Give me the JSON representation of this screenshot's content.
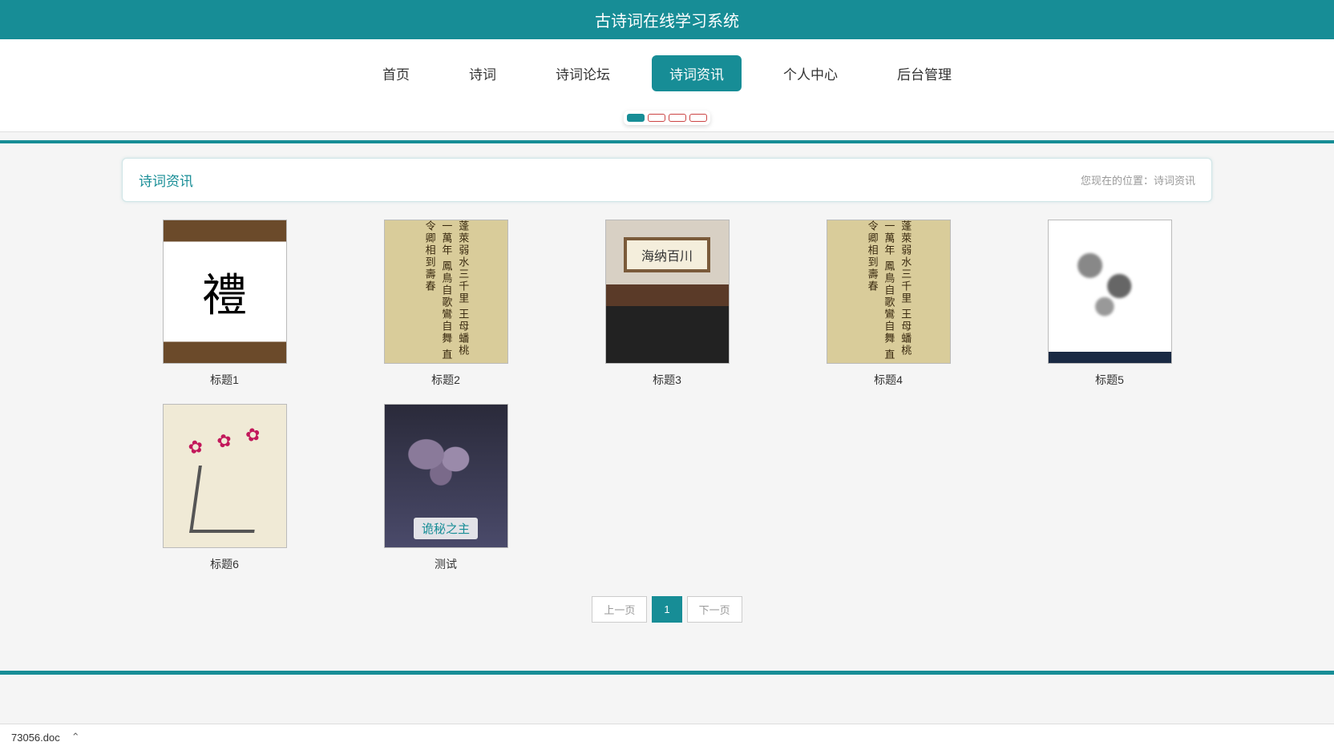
{
  "header": {
    "title": "古诗词在线学习系统"
  },
  "nav": {
    "items": [
      {
        "label": "首页"
      },
      {
        "label": "诗词"
      },
      {
        "label": "诗词论坛"
      },
      {
        "label": "诗词资讯",
        "active": true
      },
      {
        "label": "个人中心"
      },
      {
        "label": "后台管理"
      }
    ]
  },
  "panel": {
    "title": "诗词资讯",
    "breadcrumb_prefix": "您现在的位置：",
    "breadcrumb_current": "诗词资讯"
  },
  "grid": {
    "items": [
      {
        "title": "标题1",
        "art": "fan"
      },
      {
        "title": "标题2",
        "art": "calli"
      },
      {
        "title": "标题3",
        "art": "office"
      },
      {
        "title": "标题4",
        "art": "calli"
      },
      {
        "title": "标题5",
        "art": "ink"
      },
      {
        "title": "标题6",
        "art": "plum"
      },
      {
        "title": "测试",
        "art": "anime",
        "overlay": "诡秘之主"
      }
    ]
  },
  "calligraphy_sample": "蓬萊弱水三千里 王母蟠桃一萬年 鳳鳥自歌鸞自舞 直令卿相到壽春",
  "pagination": {
    "prev": "上一页",
    "next": "下一页",
    "current": "1"
  },
  "download": {
    "filename": "73056.doc"
  }
}
